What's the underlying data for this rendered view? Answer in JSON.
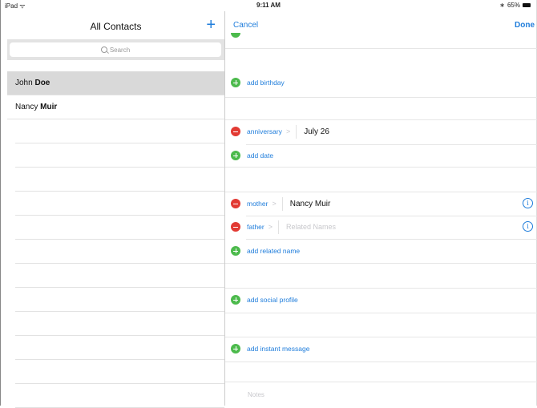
{
  "status_bar": {
    "carrier": "iPad",
    "time": "9:11 AM",
    "battery": "65%"
  },
  "sidebar": {
    "title": "All Contacts",
    "add_label": "+",
    "search_placeholder": "Search",
    "contacts": [
      {
        "first": "John",
        "last": "Doe",
        "selected": true
      },
      {
        "first": "Nancy",
        "last": "Muir",
        "selected": false
      }
    ]
  },
  "detail": {
    "cancel_label": "Cancel",
    "done_label": "Done",
    "add_birthday": "add birthday",
    "anniversary": {
      "label": "anniversary",
      "value": "July 26"
    },
    "add_date": "add date",
    "related": [
      {
        "label": "mother",
        "value": "Nancy Muir"
      },
      {
        "label": "father",
        "placeholder": "Related Names"
      }
    ],
    "add_related_name": "add related name",
    "add_social_profile": "add social profile",
    "add_instant_message": "add instant message",
    "notes_placeholder": "Notes"
  },
  "colors": {
    "accent": "#1f7ddb",
    "add_green": "#4cba4c",
    "remove_red": "#e23a33"
  }
}
